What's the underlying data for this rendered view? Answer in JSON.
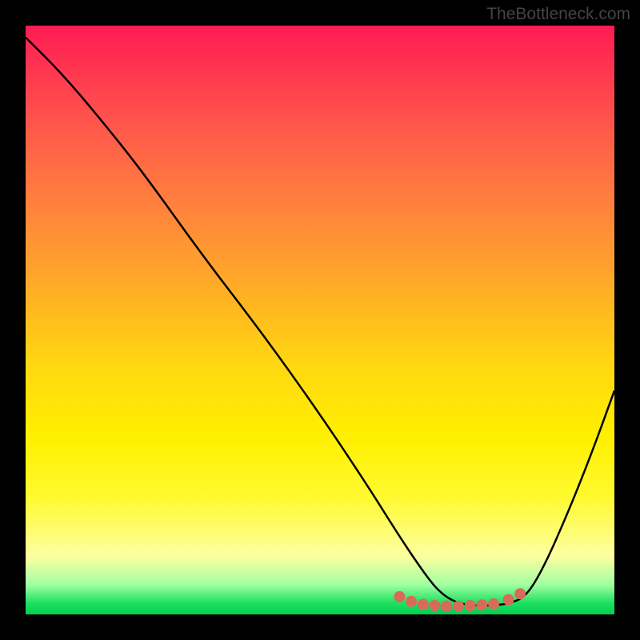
{
  "watermark": "TheBottleneck.com",
  "chart_data": {
    "type": "line",
    "title": "",
    "xlabel": "",
    "ylabel": "",
    "xlim": [
      0,
      100
    ],
    "ylim": [
      0,
      100
    ],
    "series": [
      {
        "name": "curve",
        "x": [
          0,
          6,
          12,
          20,
          30,
          40,
          50,
          58,
          63,
          67,
          70,
          73,
          76,
          79,
          82,
          85,
          88,
          92,
          96,
          100
        ],
        "values": [
          98,
          92,
          85,
          75,
          61,
          48,
          34,
          22,
          14,
          8,
          4,
          2,
          1.5,
          1.5,
          1.8,
          3,
          8,
          17,
          27,
          38
        ]
      }
    ],
    "markers": {
      "name": "dots",
      "color": "#d86a5a",
      "points": [
        {
          "x": 63.5,
          "y": 3.0
        },
        {
          "x": 65.5,
          "y": 2.2
        },
        {
          "x": 67.5,
          "y": 1.7
        },
        {
          "x": 69.5,
          "y": 1.5
        },
        {
          "x": 71.5,
          "y": 1.4
        },
        {
          "x": 73.5,
          "y": 1.4
        },
        {
          "x": 75.5,
          "y": 1.5
        },
        {
          "x": 77.5,
          "y": 1.6
        },
        {
          "x": 79.5,
          "y": 1.8
        },
        {
          "x": 82.0,
          "y": 2.5
        },
        {
          "x": 84.0,
          "y": 3.5
        }
      ]
    }
  }
}
